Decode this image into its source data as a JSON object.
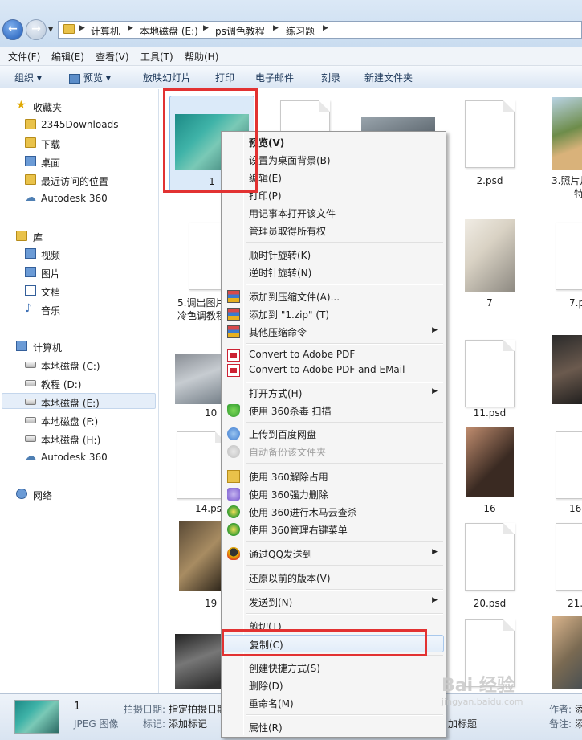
{
  "breadcrumb": [
    "计算机",
    "本地磁盘 (E:)",
    "ps调色教程",
    "练习题"
  ],
  "menu": [
    "文件(F)",
    "编辑(E)",
    "查看(V)",
    "工具(T)",
    "帮助(H)"
  ],
  "toolbar": {
    "organize": "组织 ▾",
    "preview": "预览 ▾",
    "slideshow": "放映幻灯片",
    "print": "打印",
    "email": "电子邮件",
    "burn": "刻录",
    "new_folder": "新建文件夹"
  },
  "nav": {
    "favorites": "收藏夹",
    "downloads2345": "2345Downloads",
    "downloads": "下载",
    "desktop": "桌面",
    "recent": "最近访问的位置",
    "autodesk1": "Autodesk 360",
    "libraries": "库",
    "videos": "视频",
    "pictures": "图片",
    "documents": "文档",
    "music": "音乐",
    "computer": "计算机",
    "drive_c": "本地磁盘 (C:)",
    "drive_d": "教程 (D:)",
    "drive_e": "本地磁盘 (E:)",
    "drive_f": "本地磁盘 (F:)",
    "drive_h": "本地磁盘 (H:)",
    "autodesk2": "Autodesk 360",
    "network": "网络"
  },
  "files": {
    "f1": "1",
    "f2": "2.psd",
    "f3": "3.照片片",
    "f3b": "特",
    "f5": "5.调出图片",
    "f5b": "冷色调教程",
    "f7": "7",
    "f7psd": "7.p",
    "f10": "10",
    "f11": "11.psd",
    "f14": "14.ps",
    "f16": "16",
    "f16psd": "16.",
    "f19": "19",
    "f20": "20.psd",
    "f21": "21."
  },
  "details": {
    "name": "1",
    "type": "JPEG 图像",
    "date_label": "拍摄日期:",
    "date_value": "指定拍摄日期",
    "tags_label": "标记:",
    "tags_value": "添加标记",
    "author_label": "作者:",
    "author_value": "添",
    "notes_label": "备注:",
    "notes_value": "添",
    "title_frag": "加标题"
  },
  "context_menu": {
    "preview": "预览(V)",
    "set_bg": "设置为桌面背景(B)",
    "edit": "编辑(E)",
    "print": "打印(P)",
    "notepad": "用记事本打开该文件",
    "ownership": "管理员取得所有权",
    "rot_cw": "顺时针旋转(K)",
    "rot_ccw": "逆时针旋转(N)",
    "add_archive": "添加到压缩文件(A)...",
    "add_zip": "添加到 \"1.zip\" (T)",
    "other_compress": "其他压缩命令",
    "pdf": "Convert to Adobe PDF",
    "pdf_email": "Convert to Adobe PDF and EMail",
    "open_with": "打开方式(H)",
    "scan360": "使用 360杀毒 扫描",
    "baidu_upload": "上传到百度网盘",
    "baidu_backup": "自动备份该文件夹",
    "unlock360": "使用 360解除占用",
    "force_delete": "使用 360强力删除",
    "trojan_scan": "使用 360进行木马云查杀",
    "manage_menu": "使用 360管理右键菜单",
    "qq_send": "通过QQ发送到",
    "restore": "还原以前的版本(V)",
    "send_to": "发送到(N)",
    "cut": "剪切(T)",
    "copy": "复制(C)",
    "shortcut": "创建快捷方式(S)",
    "delete": "删除(D)",
    "rename": "重命名(M)",
    "properties": "属性(R)"
  },
  "watermark": "Bai 经验",
  "watermark_url": "jingyan.baidu.com"
}
